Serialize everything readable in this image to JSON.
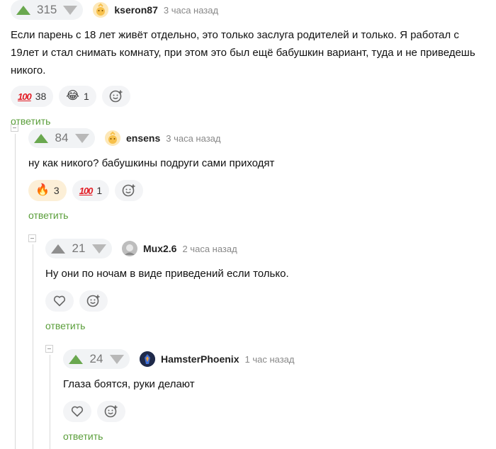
{
  "comments": [
    {
      "rating": "315",
      "author": "kseron87",
      "time": "3 часа назад",
      "text": "Если парень с 18 лет живёт отдельно, это только заслуга родителей и только. Я работал с 19лет и стал снимать комнату, при этом это был ещё бабушкин вариант, туда и не приведешь никого.",
      "reactions": [
        {
          "emoji": "hundred-points",
          "glyph": "100",
          "count": "38"
        },
        {
          "emoji": "rofl",
          "glyph": "😂",
          "count": "1"
        }
      ],
      "reply_label": "ответить"
    },
    {
      "rating": "84",
      "author": "ensens",
      "time": "3 часа назад",
      "text": "ну как никого? бабушкины подруги сами приходят",
      "reactions": [
        {
          "emoji": "fire",
          "glyph": "🔥",
          "count": "3"
        },
        {
          "emoji": "hundred-points",
          "glyph": "100",
          "count": "1"
        }
      ],
      "reply_label": "ответить"
    },
    {
      "rating": "21",
      "author": "Mux2.6",
      "time": "2 часа назад",
      "text": "Ну они по ночам в виде приведений если только.",
      "reply_label": "ответить"
    },
    {
      "rating": "24",
      "author": "HamsterPhoenix",
      "time": "1 час назад",
      "text": "Глаза боятся, руки делают",
      "reply_label": "ответить"
    }
  ],
  "colors": {
    "upvote": "#6aa84f",
    "reply": "#5a9e3a",
    "hundred": "#e21c24"
  }
}
